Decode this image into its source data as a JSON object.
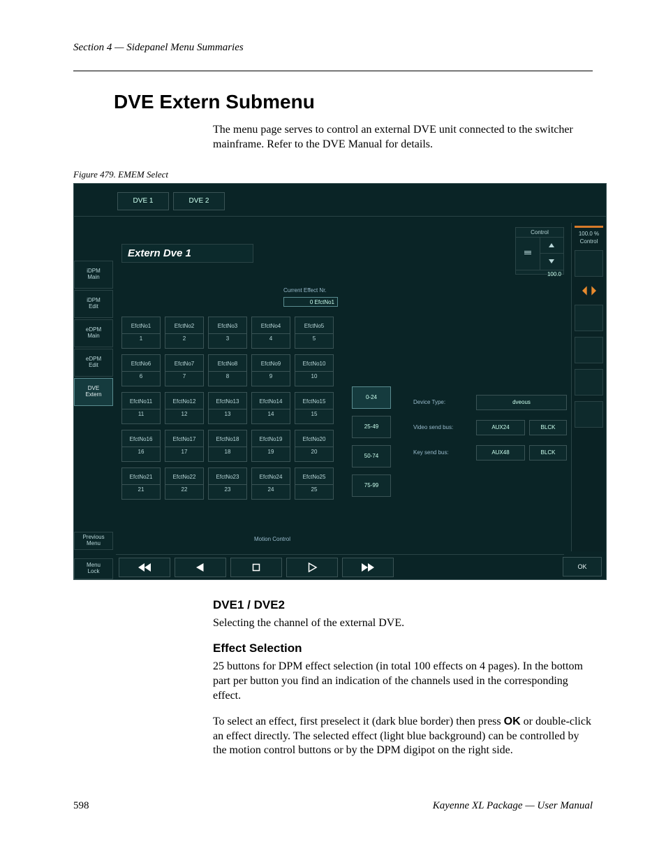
{
  "running_head": "Section 4 — Sidepanel Menu Summaries",
  "h1": "DVE Extern Submenu",
  "intro": "The menu page serves to control an external DVE unit connected to the switcher mainframe. Refer to the DVE Manual for details.",
  "figure_caption": "Figure 479.  EMEM Select",
  "screenshot": {
    "tabs": [
      "DVE 1",
      "DVE 2"
    ],
    "title": "Extern Dve 1",
    "side_items": [
      {
        "l1": "iDPM",
        "l2": "Main"
      },
      {
        "l1": "iDPM",
        "l2": "Edit"
      },
      {
        "l1": "eDPM",
        "l2": "Main"
      },
      {
        "l1": "eDPM",
        "l2": "Edit"
      },
      {
        "l1": "DVE",
        "l2": "Extern",
        "selected": true
      }
    ],
    "side_prev": {
      "l1": "Previous",
      "l2": "Menu"
    },
    "side_lock": {
      "l1": "Menu",
      "l2": "Lock"
    },
    "current_effect_label": "Current Effect Nr.",
    "current_effect_value": "0  EfctNo1",
    "effects": [
      {
        "name": "EfctNo1",
        "num": "1"
      },
      {
        "name": "EfctNo2",
        "num": "2"
      },
      {
        "name": "EfctNo3",
        "num": "3"
      },
      {
        "name": "EfctNo4",
        "num": "4"
      },
      {
        "name": "EfctNo5",
        "num": "5"
      },
      {
        "name": "EfctNo6",
        "num": "6"
      },
      {
        "name": "EfctNo7",
        "num": "7"
      },
      {
        "name": "EfctNo8",
        "num": "8"
      },
      {
        "name": "EfctNo9",
        "num": "9"
      },
      {
        "name": "EfctNo10",
        "num": "10"
      },
      {
        "name": "EfctNo11",
        "num": "11"
      },
      {
        "name": "EfctNo12",
        "num": "12"
      },
      {
        "name": "EfctNo13",
        "num": "13"
      },
      {
        "name": "EfctNo14",
        "num": "14"
      },
      {
        "name": "EfctNo15",
        "num": "15"
      },
      {
        "name": "EfctNo16",
        "num": "16"
      },
      {
        "name": "EfctNo17",
        "num": "17"
      },
      {
        "name": "EfctNo18",
        "num": "18"
      },
      {
        "name": "EfctNo19",
        "num": "19"
      },
      {
        "name": "EfctNo20",
        "num": "20"
      },
      {
        "name": "EfctNo21",
        "num": "21"
      },
      {
        "name": "EfctNo22",
        "num": "22"
      },
      {
        "name": "EfctNo23",
        "num": "23"
      },
      {
        "name": "EfctNo24",
        "num": "24"
      },
      {
        "name": "EfctNo25",
        "num": "25"
      }
    ],
    "pages": [
      {
        "label": "0-24",
        "selected": true
      },
      {
        "label": "25-49"
      },
      {
        "label": "50-74"
      },
      {
        "label": "75-99"
      }
    ],
    "device_rows": [
      {
        "label": "Device Type:",
        "val1": "dveous",
        "val2": ""
      },
      {
        "label": "Video send bus:",
        "val1": "AUX24",
        "val2": "BLCK"
      },
      {
        "label": "Key send bus:",
        "val1": "AUX48",
        "val2": "BLCK"
      }
    ],
    "motion_label": "Motion Control",
    "ok_label": "OK",
    "control": {
      "header": "Control",
      "value": "100.0"
    },
    "rcol": {
      "pct": "100.0 %",
      "label": "Control"
    }
  },
  "h2a": "DVE1 / DVE2",
  "p1": "Selecting the channel of the external DVE.",
  "h2b": "Effect Selection",
  "p2": "25 buttons for DPM effect selection (in total 100 effects on 4 pages). In the bottom part per button you find an indication of the channels used in the corresponding effect.",
  "p3_a": "To select an effect, first preselect it (dark blue border) then press ",
  "p3_ok": "OK",
  "p3_b": " or double-click an effect directly. The selected effect (light blue background) can be controlled by the motion control buttons or by the DPM digipot on the right side.",
  "footer_page": "598",
  "footer_book": "Kayenne XL Package — User Manual"
}
